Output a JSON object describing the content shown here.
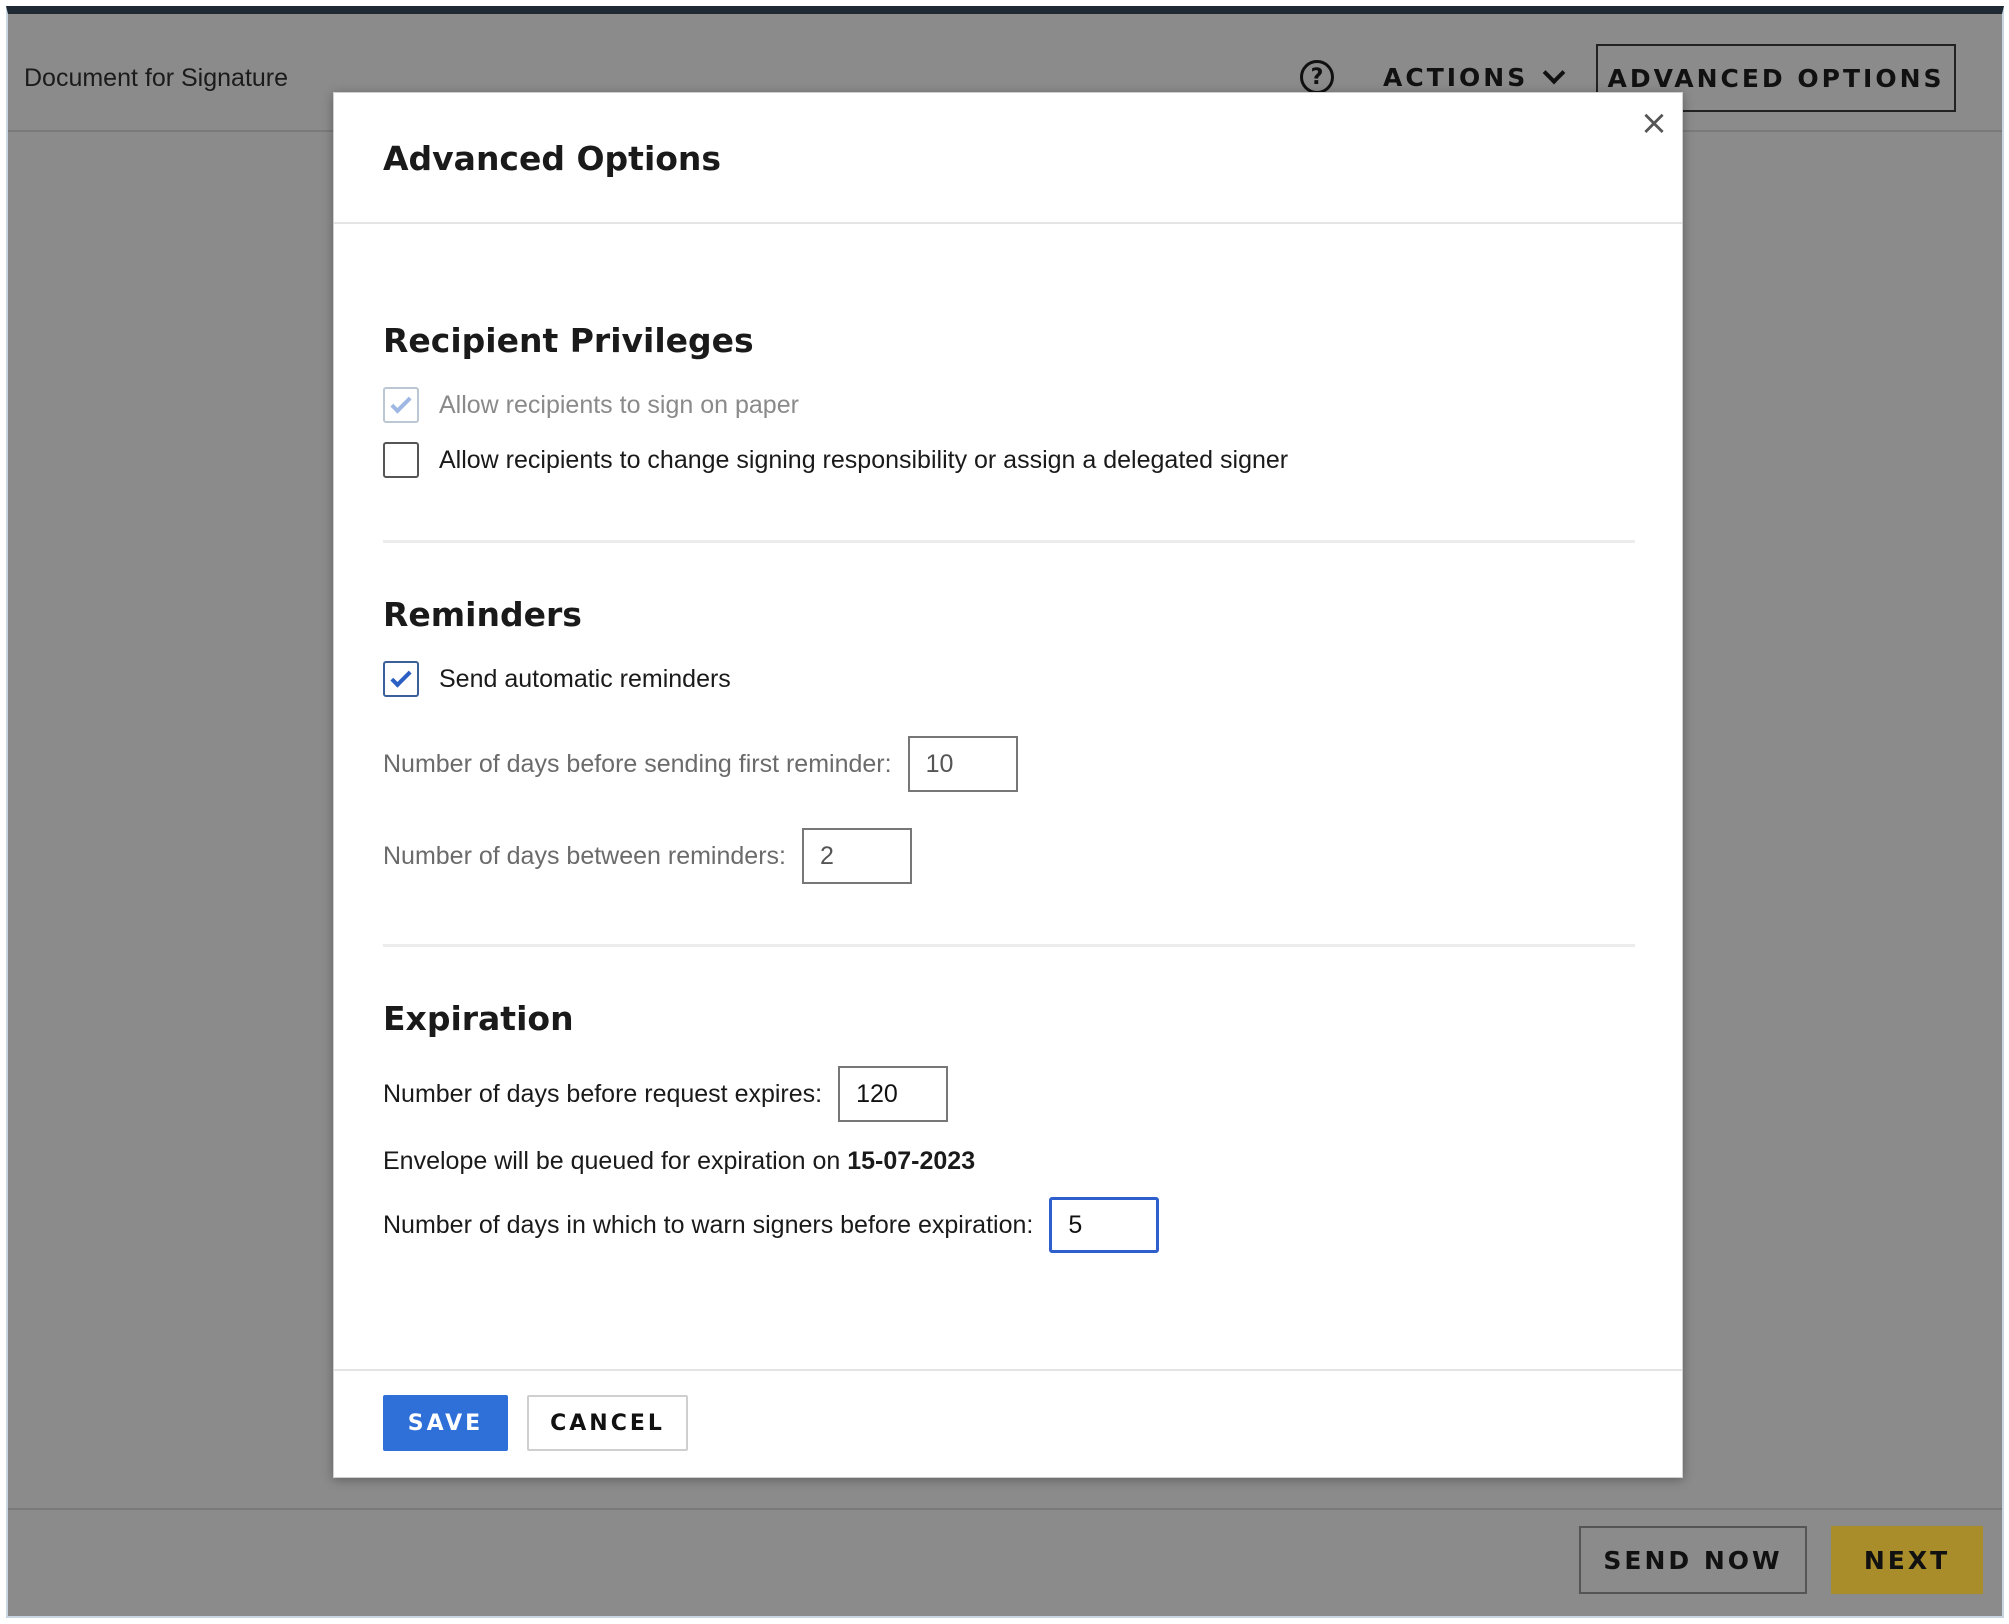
{
  "background": {
    "document_title": "Document for Signature",
    "help_icon_glyph": "?",
    "actions_label": "ACTIONS",
    "advanced_options_label": "ADVANCED OPTIONS",
    "send_now_label": "SEND NOW",
    "next_label": "NEXT",
    "next_color": "#a88d2a"
  },
  "modal": {
    "title": "Advanced Options",
    "close_glyph": "×",
    "recipient_privileges": {
      "title": "Recipient Privileges",
      "options": [
        {
          "label": "Allow recipients to sign on paper",
          "checked": true,
          "disabled": true
        },
        {
          "label": "Allow recipients to change signing responsibility or assign a delegated signer",
          "checked": false,
          "disabled": false
        }
      ]
    },
    "reminders": {
      "title": "Reminders",
      "auto_reminders_label": "Send automatic reminders",
      "auto_reminders_checked": true,
      "first_reminder_label": "Number of days before sending first reminder:",
      "first_reminder_value": "10",
      "between_label": "Number of days between reminders:",
      "between_value": "2"
    },
    "expiration": {
      "title": "Expiration",
      "expires_label": "Number of days before request expires:",
      "expires_value": "120",
      "queued_text": "Envelope will be queued for expiration on",
      "queued_date": "15-07-2023",
      "warn_label": "Number of days in which to warn signers before expiration:",
      "warn_value": "5"
    },
    "save_label": "SAVE",
    "cancel_label": "CANCEL",
    "accent_color": "#2f6fd8"
  }
}
